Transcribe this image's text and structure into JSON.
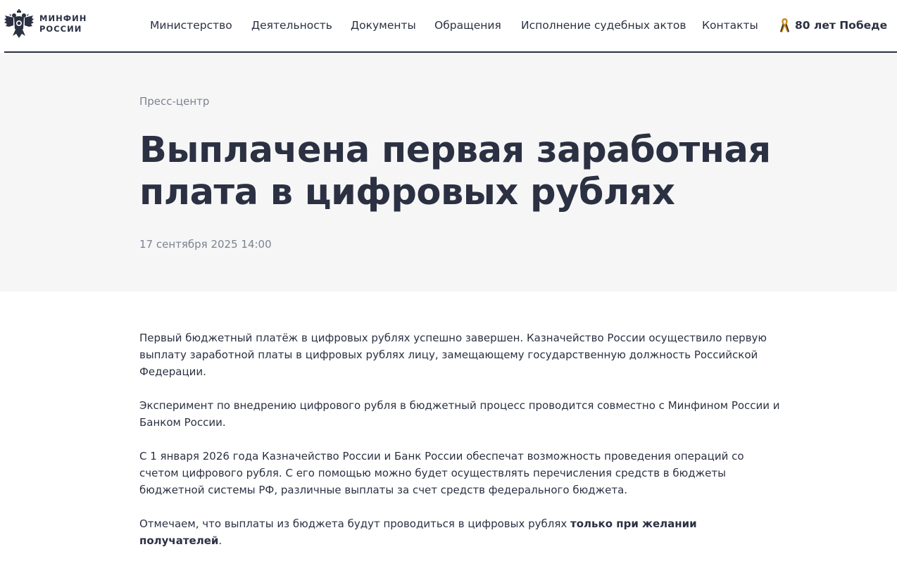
{
  "logo": {
    "line1": "МИНФИН",
    "line2": "РОССИИ",
    "icon": "double-headed-eagle-emblem"
  },
  "nav": {
    "items": [
      {
        "label": "Министерство"
      },
      {
        "label": "Деятельность"
      },
      {
        "label": "Документы"
      },
      {
        "label": "Обращения"
      },
      {
        "label": "Исполнение судебных актов"
      },
      {
        "label": "Контакты"
      }
    ],
    "victory": {
      "label": "80 лет Победе",
      "icon": "st-george-ribbon-icon",
      "color": "#c58a1b"
    }
  },
  "hero": {
    "breadcrumb": "Пресс-центр",
    "title": "Выплачена первая заработная плата в цифровых рублях",
    "date": "17 сентября 2025 14:00"
  },
  "article": {
    "p1": "Первый бюджетный платёж в цифровых рублях успешно завершен. Казначейство России осуществило первую выплату заработной платы в цифровых рублях лицу, замещающему государственную должность Российской Федерации.",
    "p2": "Эксперимент по внедрению цифрового рубля в бюджетный процесс проводится совместно с Минфином России и Банком России.",
    "p3": "С 1 января 2026 года Казначейство России и Банк России обеспечат возможность проведения операций со счетом цифрового рубля. С его помощью можно будет осуществлять перечисления средств в бюджеты бюджетной системы РФ, различные выплаты за счет средств федерального бюджета.",
    "p4_text": "Отмечаем, что выплаты из бюджета будут проводиться в цифровых рублях ",
    "p4_bold": "только при желании получателей",
    "p4_end": "."
  },
  "colors": {
    "text": "#2b3142",
    "muted": "#7d828f",
    "hero_bg": "#f6f6f7"
  }
}
